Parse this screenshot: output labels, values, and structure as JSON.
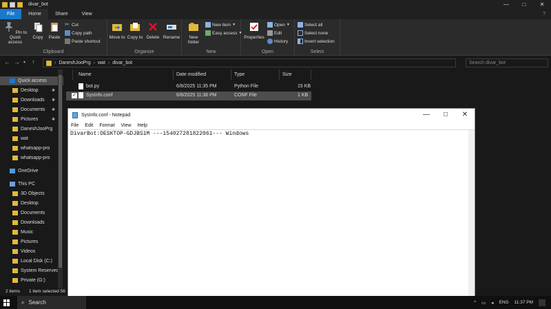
{
  "explorer": {
    "title": "divar_bot",
    "controls": {
      "minimize": "—",
      "maximize": "□",
      "close": "✕"
    },
    "tabs": [
      "File",
      "Home",
      "Share",
      "View"
    ],
    "help": "?",
    "ribbon": {
      "clipboard": {
        "label": "Clipboard",
        "pin": "Pin to Quick access",
        "copy": "Copy",
        "paste": "Paste",
        "cut": "Cut",
        "copy_path": "Copy path",
        "paste_shortcut": "Paste shortcut"
      },
      "organize": {
        "label": "Organize",
        "move_to": "Move to",
        "copy_to": "Copy to",
        "delete": "Delete",
        "rename": "Rename"
      },
      "new": {
        "label": "New",
        "new_folder": "New folder",
        "new_item": "New item",
        "easy_access": "Easy access"
      },
      "open": {
        "label": "Open",
        "properties": "Properties",
        "open": "Open",
        "edit": "Edit",
        "history": "History"
      },
      "select": {
        "label": "Select",
        "select_all": "Select all",
        "select_none": "Select none",
        "invert": "Invert selection"
      }
    },
    "address": {
      "crumbs": [
        "DaneshJooPrg",
        "wat",
        "divar_bot"
      ],
      "search_placeholder": "Search divar_bot"
    },
    "nav": [
      {
        "label": "Quick access",
        "pinned": false
      },
      {
        "label": "Desktop",
        "pinned": true
      },
      {
        "label": "Downloads",
        "pinned": true
      },
      {
        "label": "Documents",
        "pinned": true
      },
      {
        "label": "Pictures",
        "pinned": true
      },
      {
        "label": "DaneshJooPrg",
        "pinned": false
      },
      {
        "label": "wat",
        "pinned": false
      },
      {
        "label": "whatsapp-pro",
        "pinned": false
      },
      {
        "label": "whatsapp-pro",
        "pinned": false
      },
      {
        "label": "OneDrive",
        "pinned": false
      },
      {
        "label": "This PC",
        "pinned": false
      },
      {
        "label": "3D Objects",
        "pinned": false
      },
      {
        "label": "Desktop",
        "pinned": false
      },
      {
        "label": "Documents",
        "pinned": false
      },
      {
        "label": "Downloads",
        "pinned": false
      },
      {
        "label": "Music",
        "pinned": false
      },
      {
        "label": "Pictures",
        "pinned": false
      },
      {
        "label": "Videos",
        "pinned": false
      },
      {
        "label": "Local Disk (C:)",
        "pinned": false
      },
      {
        "label": "System Reserved",
        "pinned": false
      },
      {
        "label": "Private (G:)",
        "pinned": false
      }
    ],
    "columns": {
      "name": "Name",
      "date": "Date modified",
      "type": "Type",
      "size": "Size"
    },
    "files": [
      {
        "name": "bot.py",
        "date": "6/8/2025 11:35 PM",
        "type": "Python File",
        "size": "15 KB"
      },
      {
        "name": "SysInfo.conf",
        "date": "6/8/2025 11:36 PM",
        "type": "CONF File",
        "size": "1 KB"
      }
    ],
    "status": {
      "items": "2 items",
      "selected": "1 item selected  56"
    }
  },
  "notepad": {
    "title": "SysInfo.conf - Notepad",
    "menu": [
      "File",
      "Edit",
      "Format",
      "View",
      "Help"
    ],
    "content": "DivarBot:DESKTOP-GDJBS1M ---1540272818220­61--- Windows"
  },
  "taskbar": {
    "search": "Search",
    "lang": "ENG",
    "time": "11:37 PM"
  },
  "colors": {
    "accent": "#1979ca",
    "dark_bg": "#191919",
    "ribbon_bg": "#2b2b2b"
  }
}
